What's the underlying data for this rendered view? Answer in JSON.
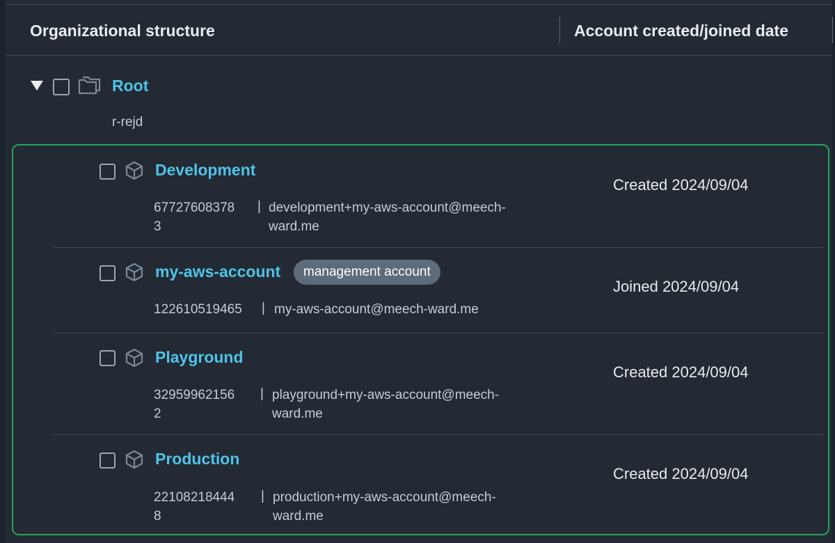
{
  "header": {
    "org_structure": "Organizational structure",
    "account_date": "Account created/joined date"
  },
  "root": {
    "name": "Root",
    "id": "r-rejd",
    "icon": "folder-icon"
  },
  "accounts": [
    {
      "name": "Development",
      "account_id_line1": "67727608378",
      "account_id_line2": "3",
      "email_line1": "development+my-aws-account@meech-",
      "email_line2": "ward.me",
      "date": "Created 2024/09/04",
      "icon": "cube-icon"
    },
    {
      "name": "my-aws-account",
      "badge": "management account",
      "account_id_line1": "122610519465",
      "email_line1": "my-aws-account@meech-ward.me",
      "date": "Joined 2024/09/04",
      "icon": "cube-icon"
    },
    {
      "name": "Playground",
      "account_id_line1": "32959962156",
      "account_id_line2": "2",
      "email_line1": "playground+my-aws-account@meech-",
      "email_line2": "ward.me",
      "date": "Created 2024/09/04",
      "icon": "cube-icon"
    },
    {
      "name": "Production",
      "account_id_line1": "22108218444",
      "account_id_line2": "8",
      "email_line1": "production+my-aws-account@meech-",
      "email_line2": "ward.me",
      "date": "Created 2024/09/04",
      "icon": "cube-icon"
    }
  ],
  "separator": "|",
  "colors": {
    "link": "#4fc3e8",
    "highlight_border": "#29a35a",
    "badge_bg": "#5f6b7a",
    "background": "#232a33"
  }
}
